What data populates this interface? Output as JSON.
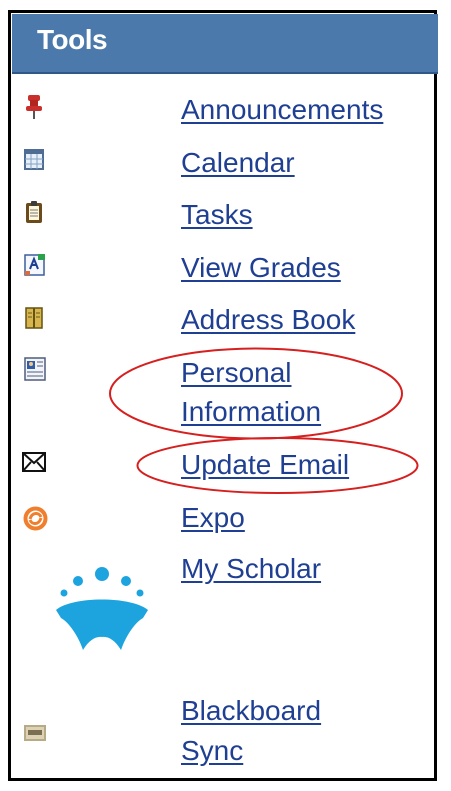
{
  "panel": {
    "title": "Tools"
  },
  "items": [
    {
      "label": "Announcements",
      "icon": "pushpin-icon"
    },
    {
      "label": "Calendar",
      "icon": "calendar-icon"
    },
    {
      "label": "Tasks",
      "icon": "clipboard-icon"
    },
    {
      "label": "View Grades",
      "icon": "grades-icon"
    },
    {
      "label": "Address Book",
      "icon": "address-book-icon"
    },
    {
      "label_line1": "Personal",
      "label_line2": "Information",
      "icon": "id-card-icon"
    },
    {
      "label": "Update Email",
      "icon": "envelope-icon"
    },
    {
      "label": "Expo",
      "icon": "expo-icon"
    },
    {
      "label": "My Scholar",
      "icon": "my-scholar-logo-icon"
    },
    {
      "label_line1": "Blackboard",
      "label_line2": "Sync",
      "icon": "blackboard-sync-icon"
    }
  ],
  "colors": {
    "header_bg": "#4b79ab",
    "link": "#1f3f93",
    "annotation": "#d61f1f",
    "my_scholar_logo": "#1da4df",
    "expo": "#f07f2d"
  }
}
